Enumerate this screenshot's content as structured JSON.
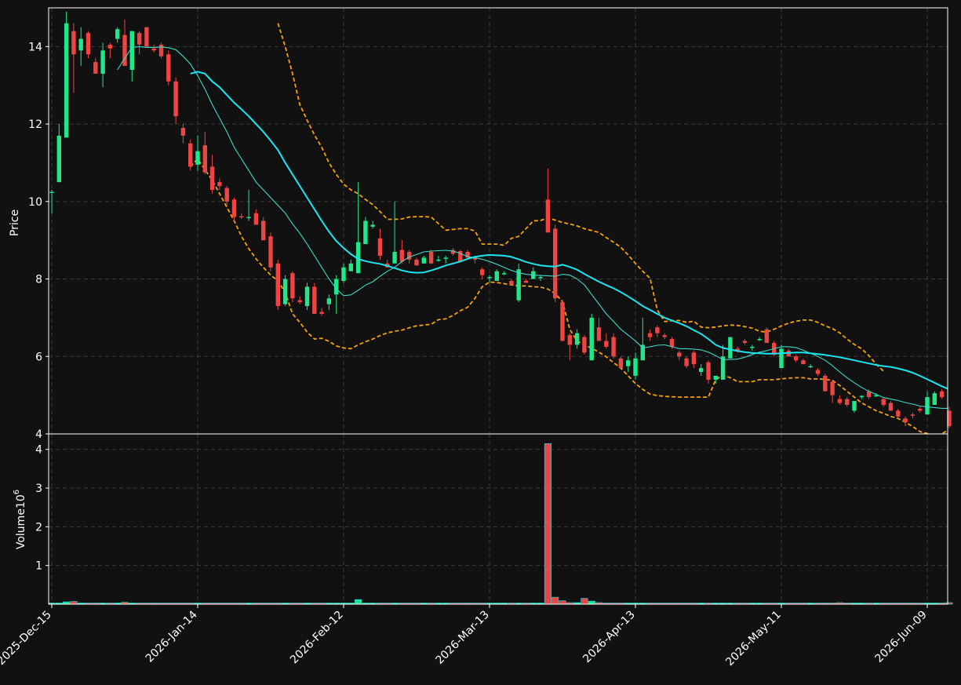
{
  "chart_data": {
    "type": "candlestick",
    "price_panel": {
      "ylabel": "Price",
      "ylim": [
        4,
        15
      ],
      "yticks": [
        4,
        6,
        8,
        10,
        12,
        14
      ],
      "grid": true
    },
    "volume_panel": {
      "ylabel": "Volume",
      "ylabel_exponent": "6",
      "ylim": [
        0,
        4.4
      ],
      "yticks": [
        1,
        2,
        3,
        4
      ],
      "grid": true
    },
    "x_tick_labels": [
      "2025-Dec-15",
      "2026-Jan-14",
      "2026-Feb-12",
      "2026-Mar-13",
      "2026-Apr-13",
      "2026-May-11",
      "2026-Jun-09"
    ],
    "x_tick_index": [
      0,
      20,
      40,
      60,
      80,
      100,
      120
    ],
    "n_bars": 124,
    "colors": {
      "up": "#1de98b",
      "down": "#ef4444",
      "ma_long": "#19e6f2",
      "ma_short": "#3ed9c8",
      "bands": "#f5a10a",
      "background": "#111111",
      "grid": "#3a3a3a",
      "frame": "#ffffff"
    },
    "ohlc": [
      [
        10.25,
        10.3,
        9.7,
        10.25
      ],
      [
        10.5,
        12.0,
        10.5,
        11.7
      ],
      [
        11.65,
        14.9,
        11.65,
        14.6
      ],
      [
        14.4,
        14.6,
        12.8,
        13.8
      ],
      [
        13.9,
        14.5,
        13.5,
        14.2
      ],
      [
        14.35,
        14.4,
        13.7,
        13.8
      ],
      [
        13.6,
        13.7,
        13.3,
        13.3
      ],
      [
        13.3,
        14.1,
        12.95,
        13.9
      ],
      [
        14.05,
        14.1,
        13.7,
        13.95
      ],
      [
        14.2,
        14.5,
        14.1,
        14.45
      ],
      [
        14.3,
        14.7,
        13.5,
        13.5
      ],
      [
        13.4,
        14.4,
        13.1,
        14.4
      ],
      [
        14.35,
        14.4,
        13.8,
        14.05
      ],
      [
        14.5,
        14.5,
        14.0,
        14.0
      ],
      [
        13.95,
        14.05,
        13.85,
        13.9
      ],
      [
        14.05,
        14.1,
        13.7,
        13.75
      ],
      [
        13.8,
        13.9,
        13.0,
        13.1
      ],
      [
        13.1,
        13.2,
        12.0,
        12.2
      ],
      [
        11.9,
        12.0,
        11.5,
        11.7
      ],
      [
        11.5,
        11.6,
        10.8,
        10.9
      ],
      [
        10.95,
        11.7,
        10.8,
        11.3
      ],
      [
        11.45,
        11.8,
        10.7,
        10.75
      ],
      [
        10.9,
        11.2,
        10.2,
        10.3
      ],
      [
        10.5,
        10.6,
        10.3,
        10.4
      ],
      [
        10.35,
        10.4,
        9.9,
        10.0
      ],
      [
        10.05,
        10.1,
        9.5,
        9.6
      ],
      [
        9.62,
        9.7,
        9.55,
        9.6
      ],
      [
        9.6,
        10.3,
        9.5,
        9.6
      ],
      [
        9.7,
        9.8,
        9.4,
        9.4
      ],
      [
        9.5,
        9.6,
        9.0,
        9.0
      ],
      [
        9.1,
        9.2,
        8.2,
        8.3
      ],
      [
        8.4,
        8.5,
        7.2,
        7.3
      ],
      [
        7.35,
        8.1,
        7.3,
        8.0
      ],
      [
        8.15,
        8.2,
        7.4,
        7.5
      ],
      [
        7.45,
        7.55,
        7.35,
        7.4
      ],
      [
        7.3,
        7.9,
        7.2,
        7.8
      ],
      [
        7.8,
        7.9,
        7.1,
        7.1
      ],
      [
        7.15,
        7.25,
        7.05,
        7.1
      ],
      [
        7.35,
        7.6,
        7.2,
        7.5
      ],
      [
        7.6,
        8.1,
        7.1,
        8.0
      ],
      [
        7.95,
        8.4,
        7.9,
        8.3
      ],
      [
        8.2,
        8.5,
        8.2,
        8.4
      ],
      [
        8.15,
        10.5,
        8.15,
        8.95
      ],
      [
        8.9,
        9.6,
        8.9,
        9.5
      ],
      [
        9.35,
        9.5,
        9.3,
        9.4
      ],
      [
        9.05,
        9.3,
        8.5,
        8.6
      ],
      [
        8.4,
        8.5,
        8.3,
        8.3
      ],
      [
        8.4,
        10.0,
        8.4,
        8.7
      ],
      [
        8.75,
        9.0,
        8.4,
        8.45
      ],
      [
        8.7,
        8.75,
        8.4,
        8.5
      ],
      [
        8.5,
        8.55,
        8.35,
        8.35
      ],
      [
        8.4,
        8.6,
        8.4,
        8.55
      ],
      [
        8.7,
        8.75,
        8.4,
        8.4
      ],
      [
        8.5,
        8.6,
        8.45,
        8.5
      ],
      [
        8.55,
        8.6,
        8.4,
        8.55
      ],
      [
        8.75,
        8.8,
        8.6,
        8.65
      ],
      [
        8.72,
        8.75,
        8.45,
        8.45
      ],
      [
        8.7,
        8.75,
        8.5,
        8.55
      ],
      [
        8.55,
        8.6,
        8.4,
        8.5
      ],
      [
        8.25,
        8.3,
        8.0,
        8.1
      ],
      [
        8.05,
        8.1,
        7.9,
        8.05
      ],
      [
        7.95,
        8.25,
        7.95,
        8.2
      ],
      [
        8.15,
        8.2,
        8.1,
        8.15
      ],
      [
        7.95,
        8.0,
        7.85,
        7.85
      ],
      [
        7.45,
        8.4,
        7.4,
        8.25
      ],
      [
        7.95,
        8.0,
        7.9,
        7.9
      ],
      [
        8.0,
        8.3,
        8.0,
        8.2
      ],
      [
        8.05,
        8.1,
        7.95,
        8.05
      ],
      [
        10.05,
        10.85,
        9.2,
        9.2
      ],
      [
        9.3,
        9.4,
        7.4,
        7.5
      ],
      [
        7.4,
        7.45,
        6.4,
        6.4
      ],
      [
        6.55,
        6.6,
        5.9,
        6.3
      ],
      [
        6.3,
        6.7,
        6.2,
        6.6
      ],
      [
        6.5,
        6.55,
        6.05,
        6.1
      ],
      [
        5.9,
        7.1,
        5.9,
        7.0
      ],
      [
        6.75,
        7.0,
        6.4,
        6.4
      ],
      [
        6.4,
        6.6,
        6.2,
        6.25
      ],
      [
        6.5,
        6.6,
        5.95,
        6.0
      ],
      [
        5.95,
        6.0,
        5.7,
        5.7
      ],
      [
        5.75,
        6.0,
        5.6,
        5.9
      ],
      [
        5.5,
        6.1,
        5.4,
        5.95
      ],
      [
        5.9,
        7.0,
        5.9,
        6.3
      ],
      [
        6.6,
        6.7,
        6.4,
        6.5
      ],
      [
        6.75,
        6.8,
        6.5,
        6.6
      ],
      [
        6.55,
        6.6,
        6.45,
        6.5
      ],
      [
        6.45,
        6.5,
        6.2,
        6.25
      ],
      [
        6.1,
        6.15,
        5.9,
        6.0
      ],
      [
        5.95,
        6.0,
        5.7,
        5.75
      ],
      [
        6.1,
        6.15,
        5.7,
        5.8
      ],
      [
        5.6,
        5.8,
        5.5,
        5.7
      ],
      [
        5.85,
        5.9,
        5.3,
        5.4
      ],
      [
        5.4,
        5.5,
        5.3,
        5.5
      ],
      [
        5.4,
        6.3,
        5.4,
        6.0
      ],
      [
        5.95,
        6.5,
        5.95,
        6.5
      ],
      [
        6.2,
        6.25,
        6.1,
        6.15
      ],
      [
        6.4,
        6.45,
        6.3,
        6.35
      ],
      [
        6.25,
        6.3,
        6.15,
        6.25
      ],
      [
        6.45,
        6.5,
        6.4,
        6.45
      ],
      [
        6.7,
        6.75,
        6.35,
        6.35
      ],
      [
        6.35,
        6.4,
        6.0,
        6.05
      ],
      [
        5.7,
        6.3,
        5.7,
        6.2
      ],
      [
        6.15,
        6.2,
        6.0,
        6.0
      ],
      [
        6.0,
        6.05,
        5.85,
        5.9
      ],
      [
        5.9,
        5.95,
        5.8,
        5.8
      ],
      [
        5.75,
        5.8,
        5.7,
        5.75
      ],
      [
        5.65,
        5.7,
        5.5,
        5.55
      ],
      [
        5.5,
        5.55,
        5.1,
        5.1
      ],
      [
        5.35,
        5.4,
        4.8,
        5.0
      ],
      [
        4.9,
        5.0,
        4.75,
        4.8
      ],
      [
        4.9,
        4.95,
        4.7,
        4.75
      ],
      [
        4.6,
        4.85,
        4.55,
        4.85
      ],
      [
        4.95,
        5.0,
        4.9,
        4.98
      ],
      [
        5.1,
        5.15,
        4.9,
        4.95
      ],
      [
        5.0,
        5.05,
        4.95,
        5.0
      ],
      [
        4.9,
        4.95,
        4.7,
        4.75
      ],
      [
        4.8,
        4.85,
        4.6,
        4.6
      ],
      [
        4.6,
        4.65,
        4.4,
        4.45
      ],
      [
        4.4,
        4.45,
        4.2,
        4.3
      ],
      [
        4.5,
        4.55,
        4.4,
        4.48
      ],
      [
        4.65,
        4.7,
        4.55,
        4.6
      ],
      [
        4.5,
        5.1,
        4.5,
        4.95
      ],
      [
        4.75,
        5.1,
        4.75,
        5.05
      ],
      [
        5.1,
        5.15,
        4.9,
        4.95
      ],
      [
        4.6,
        4.7,
        4.15,
        4.2
      ]
    ],
    "volume": [
      0.02,
      0.03,
      0.06,
      0.07,
      0.01,
      0.02,
      0.01,
      0.01,
      0.01,
      0.01,
      0.05,
      0.02,
      0.01,
      0.03,
      0.01,
      0.03,
      0.02,
      0.02,
      0.01,
      0.01,
      0.01,
      0.01,
      0.02,
      0.01,
      0.01,
      0.02,
      0.01,
      0.01,
      0.01,
      0.02,
      0.02,
      0.03,
      0.01,
      0.02,
      0.01,
      0.01,
      0.01,
      0.01,
      0.01,
      0.01,
      0.01,
      0.01,
      0.12,
      0.01,
      0.01,
      0.01,
      0.01,
      0.02,
      0.03,
      0.01,
      0.01,
      0.01,
      0.01,
      0.01,
      0.01,
      0.01,
      0.01,
      0.01,
      0.03,
      0.01,
      0.01,
      0.01,
      0.01,
      0.01,
      0.01,
      0.01,
      0.01,
      0.01,
      4.15,
      0.18,
      0.09,
      0.04,
      0.04,
      0.15,
      0.08,
      0.04,
      0.01,
      0.01,
      0.01,
      0.01,
      0.01,
      0.02,
      0.01,
      0.01,
      0.01,
      0.01,
      0.01,
      0.01,
      0.01,
      0.01,
      0.01,
      0.01,
      0.01,
      0.01,
      0.01,
      0.01,
      0.01,
      0.01,
      0.01,
      0.01,
      0.01,
      0.01,
      0.01,
      0.01,
      0.01,
      0.01,
      0.01,
      0.01,
      0.04,
      0.01,
      0.01,
      0.01,
      0.01,
      0.01,
      0.01,
      0.01,
      0.01,
      0.01,
      0.01,
      0.01,
      0.01,
      0.01,
      0.01,
      0.04
    ],
    "ma_long": {
      "start": 19,
      "values": [
        13.3,
        13.35,
        13.3,
        13.1,
        12.95,
        12.75,
        12.55,
        12.38,
        12.2,
        12.0,
        11.8,
        11.57,
        11.33,
        11.0,
        10.7,
        10.4,
        10.1,
        9.8,
        9.5,
        9.22,
        8.98,
        8.8,
        8.64,
        8.52,
        8.46,
        8.42,
        8.39,
        8.34,
        8.28,
        8.22,
        8.18,
        8.16,
        8.17,
        8.22,
        8.28,
        8.35,
        8.4,
        8.45,
        8.52,
        8.57,
        8.6,
        8.62,
        8.61,
        8.6,
        8.57,
        8.51,
        8.44,
        8.39,
        8.35,
        8.33,
        8.32,
        8.37,
        8.31,
        8.24,
        8.13,
        8.03,
        7.93,
        7.84,
        7.76,
        7.66,
        7.55,
        7.43,
        7.3,
        7.2,
        7.1,
        7.0,
        6.93,
        6.86,
        6.78,
        6.68,
        6.58,
        6.45,
        6.3,
        6.22,
        6.18,
        6.14,
        6.11,
        6.09,
        6.08,
        6.07,
        6.07,
        6.08,
        6.09,
        6.1,
        6.1,
        6.08,
        6.06,
        6.04,
        6.01,
        5.98,
        5.94,
        5.9,
        5.86,
        5.82,
        5.78,
        5.75,
        5.73,
        5.69,
        5.64,
        5.58,
        5.5,
        5.41,
        5.32,
        5.23,
        5.15,
        5.09,
        5.04,
        4.99,
        4.94,
        4.87
      ]
    },
    "ma_short": {
      "start": 9,
      "values": [
        13.4,
        13.7,
        13.98,
        14.0,
        13.98,
        13.98,
        13.99,
        13.97,
        13.92,
        13.75,
        13.55,
        13.25,
        12.9,
        12.5,
        12.15,
        11.8,
        11.4,
        11.1,
        10.8,
        10.5,
        10.3,
        10.1,
        9.9,
        9.7,
        9.42,
        9.18,
        8.9,
        8.6,
        8.3,
        8.0,
        7.75,
        7.57,
        7.59,
        7.71,
        7.84,
        7.93,
        8.07,
        8.2,
        8.3,
        8.45,
        8.57,
        8.63,
        8.7,
        8.72,
        8.73,
        8.74,
        8.72,
        8.66,
        8.58,
        8.55,
        8.51,
        8.45,
        8.38,
        8.3,
        8.22,
        8.16,
        8.12,
        8.1,
        8.09,
        8.08,
        8.07,
        8.12,
        8.1,
        8.0,
        7.85,
        7.6,
        7.35,
        7.1,
        6.9,
        6.7,
        6.55,
        6.4,
        6.22,
        6.25,
        6.29,
        6.3,
        6.25,
        6.2,
        6.2,
        6.19,
        6.17,
        6.11,
        6.02,
        5.92,
        5.92,
        5.93,
        5.98,
        6.05,
        6.11,
        6.15,
        6.2,
        6.25,
        6.25,
        6.23,
        6.16,
        6.08,
        6.0,
        5.9,
        5.76,
        5.6,
        5.45,
        5.32,
        5.2,
        5.1,
        5.02,
        4.94,
        4.9,
        4.86,
        4.81,
        4.77,
        4.72,
        4.7,
        4.68,
        4.66,
        4.66,
        4.6
      ]
    },
    "band_upper": {
      "start": 31,
      "values": [
        14.6,
        14.0,
        13.3,
        12.5,
        12.1,
        11.72,
        11.4,
        11.0,
        10.7,
        10.45,
        10.3,
        10.2,
        10.05,
        9.92,
        9.74,
        9.54,
        9.54,
        9.55,
        9.6,
        9.61,
        9.61,
        9.6,
        9.43,
        9.26,
        9.28,
        9.3,
        9.3,
        9.24,
        8.9,
        8.9,
        8.9,
        8.87,
        9.05,
        9.1,
        9.3,
        9.5,
        9.51,
        9.58,
        9.52,
        9.46,
        9.42,
        9.37,
        9.3,
        9.25,
        9.2,
        9.07,
        8.95,
        8.82,
        8.62,
        8.4,
        8.2,
        8.02,
        7.2,
        6.9,
        6.92,
        6.93,
        6.88,
        6.91,
        6.76,
        6.74,
        6.76,
        6.79,
        6.81,
        6.8,
        6.77,
        6.73,
        6.65,
        6.63,
        6.7,
        6.79,
        6.86,
        6.91,
        6.94,
        6.94,
        6.88,
        6.79,
        6.72,
        6.61,
        6.45,
        6.31,
        6.2,
        6.02,
        5.8,
        5.62
      ]
    },
    "band_lower": {
      "start": 19,
      "values": [
        10.9,
        11.1,
        10.82,
        10.55,
        10.2,
        9.85,
        9.5,
        9.1,
        8.78,
        8.52,
        8.3,
        8.1,
        7.95,
        7.65,
        7.1,
        6.88,
        6.63,
        6.45,
        6.47,
        6.39,
        6.27,
        6.22,
        6.2,
        6.3,
        6.38,
        6.45,
        6.54,
        6.61,
        6.65,
        6.68,
        6.74,
        6.79,
        6.81,
        6.83,
        6.95,
        6.97,
        7.06,
        7.18,
        7.27,
        7.5,
        7.8,
        7.92,
        7.91,
        7.88,
        7.85,
        7.82,
        7.82,
        7.8,
        7.79,
        7.74,
        7.62,
        7.42,
        6.7,
        6.4,
        6.3,
        6.21,
        6.11,
        5.99,
        5.84,
        5.7,
        5.5,
        5.3,
        5.15,
        5.03,
        4.99,
        4.97,
        4.96,
        4.95,
        4.95,
        4.95,
        4.95,
        4.95,
        5.4,
        5.52,
        5.45,
        5.35,
        5.35,
        5.35,
        5.4,
        5.4,
        5.4,
        5.42,
        5.44,
        5.45,
        5.45,
        5.42,
        5.42,
        5.41,
        5.38,
        5.25,
        5.1,
        4.95,
        4.8,
        4.7,
        4.6,
        4.53,
        4.45,
        4.4,
        4.3,
        4.19,
        4.06,
        4.01,
        3.98,
        4.0,
        4.12,
        4.15,
        4.13
      ]
    }
  }
}
